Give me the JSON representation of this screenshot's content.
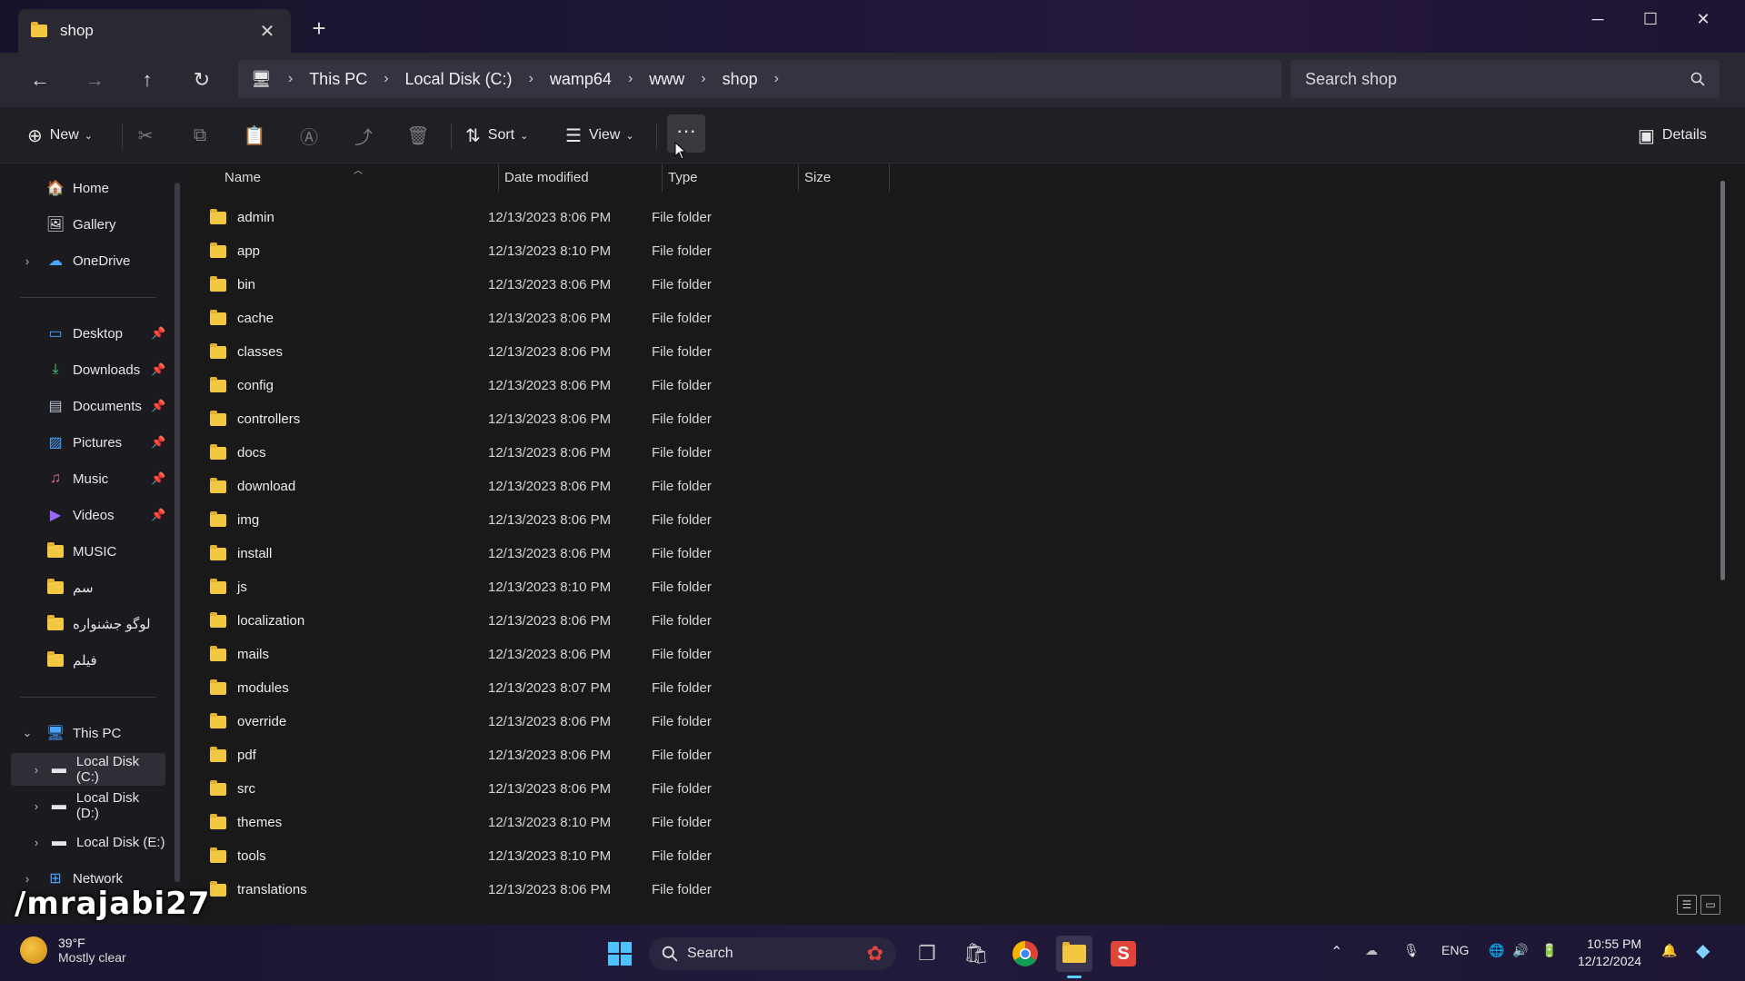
{
  "window": {
    "tab_title": "shop",
    "tab_close": "✕",
    "new_tab": "+",
    "controls": {
      "minimize": "─",
      "maximize": "☐",
      "close": "✕"
    }
  },
  "navigation": {
    "back": "←",
    "forward": "→",
    "up": "↑",
    "refresh": "↻",
    "breadcrumbs": [
      "This PC",
      "Local Disk (C:)",
      "wamp64",
      "www",
      "shop"
    ],
    "sep": "›",
    "search_placeholder": "Search shop"
  },
  "toolbar": {
    "new_label": "New",
    "sort_label": "Sort",
    "view_label": "View",
    "more_label": "···",
    "details_label": "Details"
  },
  "sidebar": {
    "quick": [
      {
        "label": "Home",
        "icon": "home-icon"
      },
      {
        "label": "Gallery",
        "icon": "gallery-icon"
      },
      {
        "label": "OneDrive",
        "icon": "cloud-icon"
      }
    ],
    "pinned": [
      {
        "label": "Desktop",
        "icon": "desktop-icon"
      },
      {
        "label": "Downloads",
        "icon": "download-icon"
      },
      {
        "label": "Documents",
        "icon": "document-icon"
      },
      {
        "label": "Pictures",
        "icon": "picture-icon"
      },
      {
        "label": "Music",
        "icon": "music-icon"
      },
      {
        "label": "Videos",
        "icon": "video-icon"
      }
    ],
    "folders": [
      "MUSIC",
      "سم",
      "لوگو جشنواره",
      "فیلم"
    ],
    "this_pc": "This PC",
    "drives": [
      "Local Disk (C:)",
      "Local Disk (D:)",
      "Local Disk (E:)"
    ],
    "network": "Network"
  },
  "columns": {
    "name": "Name",
    "date": "Date modified",
    "type": "Type",
    "size": "Size"
  },
  "files": [
    {
      "name": "admin",
      "date": "12/13/2023 8:06 PM",
      "type": "File folder"
    },
    {
      "name": "app",
      "date": "12/13/2023 8:10 PM",
      "type": "File folder"
    },
    {
      "name": "bin",
      "date": "12/13/2023 8:06 PM",
      "type": "File folder"
    },
    {
      "name": "cache",
      "date": "12/13/2023 8:06 PM",
      "type": "File folder"
    },
    {
      "name": "classes",
      "date": "12/13/2023 8:06 PM",
      "type": "File folder"
    },
    {
      "name": "config",
      "date": "12/13/2023 8:06 PM",
      "type": "File folder"
    },
    {
      "name": "controllers",
      "date": "12/13/2023 8:06 PM",
      "type": "File folder"
    },
    {
      "name": "docs",
      "date": "12/13/2023 8:06 PM",
      "type": "File folder"
    },
    {
      "name": "download",
      "date": "12/13/2023 8:06 PM",
      "type": "File folder"
    },
    {
      "name": "img",
      "date": "12/13/2023 8:06 PM",
      "type": "File folder"
    },
    {
      "name": "install",
      "date": "12/13/2023 8:06 PM",
      "type": "File folder"
    },
    {
      "name": "js",
      "date": "12/13/2023 8:10 PM",
      "type": "File folder"
    },
    {
      "name": "localization",
      "date": "12/13/2023 8:06 PM",
      "type": "File folder"
    },
    {
      "name": "mails",
      "date": "12/13/2023 8:06 PM",
      "type": "File folder"
    },
    {
      "name": "modules",
      "date": "12/13/2023 8:07 PM",
      "type": "File folder"
    },
    {
      "name": "override",
      "date": "12/13/2023 8:06 PM",
      "type": "File folder"
    },
    {
      "name": "pdf",
      "date": "12/13/2023 8:06 PM",
      "type": "File folder"
    },
    {
      "name": "src",
      "date": "12/13/2023 8:06 PM",
      "type": "File folder"
    },
    {
      "name": "themes",
      "date": "12/13/2023 8:10 PM",
      "type": "File folder"
    },
    {
      "name": "tools",
      "date": "12/13/2023 8:10 PM",
      "type": "File folder"
    },
    {
      "name": "translations",
      "date": "12/13/2023 8:06 PM",
      "type": "File folder"
    }
  ],
  "watermark": "/mrajabi27",
  "taskbar": {
    "temp": "39°F",
    "condition": "Mostly clear",
    "search": "Search",
    "lang": "ENG",
    "time": "10:55 PM",
    "date": "12/12/2024"
  },
  "colors": {
    "folder": "#f3c741",
    "accent": "#60cdff"
  }
}
